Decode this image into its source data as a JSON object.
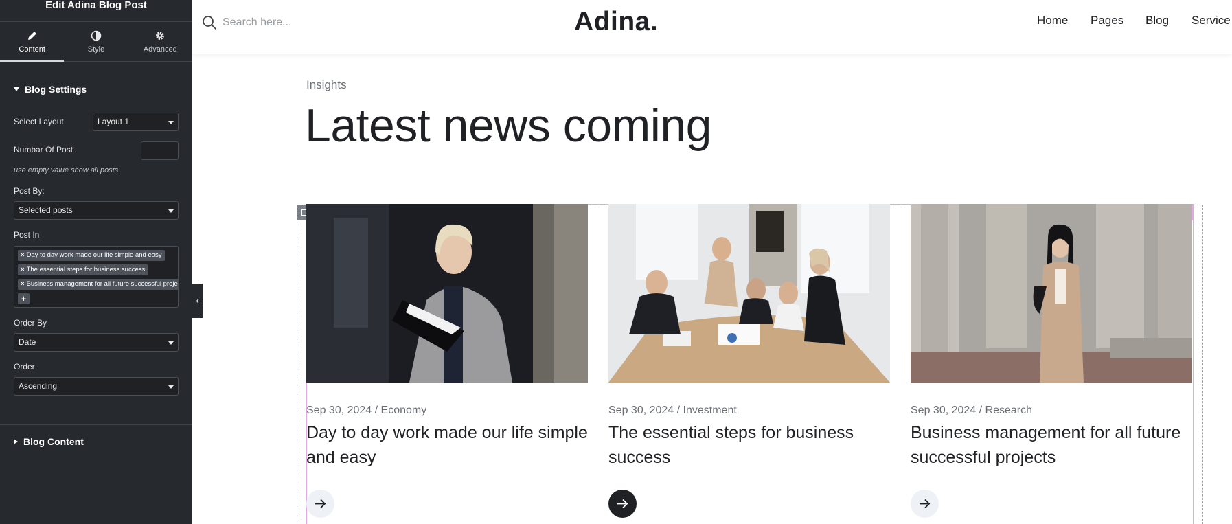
{
  "panel": {
    "title": "Edit Adina Blog Post",
    "tabs": [
      {
        "label": "Content",
        "icon": "pencil-icon",
        "active": true
      },
      {
        "label": "Style",
        "icon": "half-circle-icon",
        "active": false
      },
      {
        "label": "Advanced",
        "icon": "gear-icon",
        "active": false
      }
    ],
    "blog_settings": {
      "heading": "Blog Settings",
      "select_layout_label": "Select Layout",
      "select_layout_value": "Layout 1",
      "number_of_post_label": "Numbar Of Post",
      "number_of_post_value": "",
      "number_hint": "use empty value show all posts",
      "post_by_label": "Post By:",
      "post_by_value": "Selected posts",
      "post_in_label": "Post In",
      "post_in_chips": [
        "Day to day work made our life simple and easy",
        "The essential steps for business success",
        "Business management for all future successful projects"
      ],
      "chip_remove": "×",
      "add_label": "+",
      "order_by_label": "Order By",
      "order_by_value": "Date",
      "order_label": "Order",
      "order_value": "Ascending"
    },
    "blog_content_heading": "Blog Content",
    "collapse_label": "‹"
  },
  "header": {
    "search_placeholder": "Search here...",
    "logo": "Adina.",
    "nav": [
      "Home",
      "Pages",
      "Blog",
      "Service"
    ]
  },
  "main": {
    "eyebrow": "Insights",
    "headline": "Latest news coming",
    "posts": [
      {
        "meta": "Sep 30, 2024 / Economy",
        "title": "Day to day work made our life simple and easy",
        "arrow_active": false
      },
      {
        "meta": "Sep 30, 2024 / Investment",
        "title": "The essential steps for business success",
        "arrow_active": true
      },
      {
        "meta": "Sep 30, 2024 / Research",
        "title": "Business management for all future successful projects",
        "arrow_active": false
      }
    ]
  },
  "colors": {
    "panel_bg": "#26292d",
    "accent_pink": "#e5a6ea",
    "text_dark": "#1f2125"
  }
}
